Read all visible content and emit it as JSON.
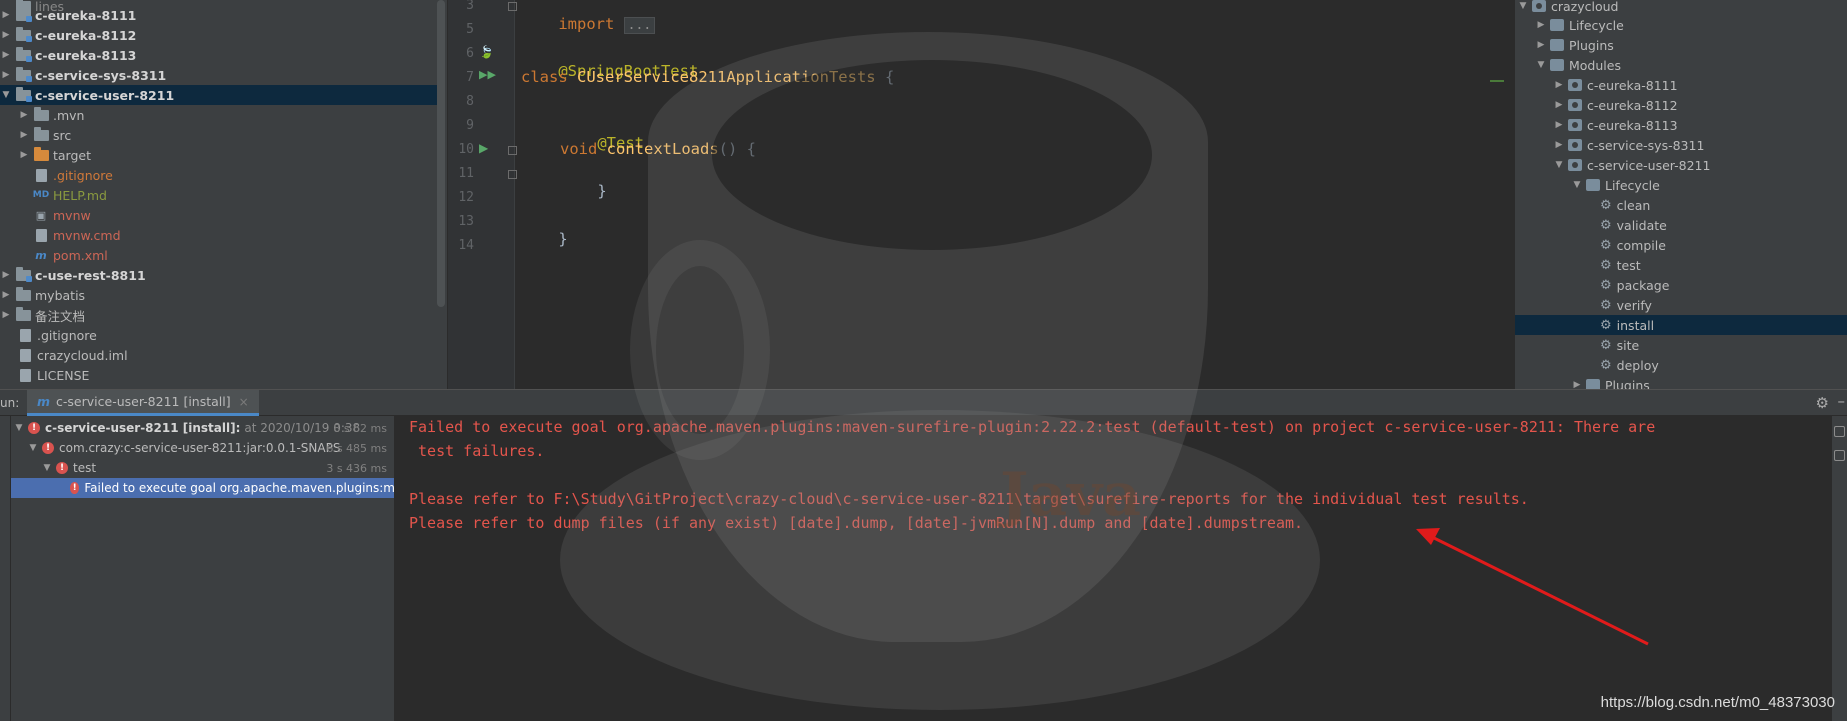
{
  "project_tree": {
    "items": [
      {
        "label": "c-eureka-8111",
        "style": "bold"
      },
      {
        "label": "c-eureka-8112",
        "style": "bold"
      },
      {
        "label": "c-eureka-8113",
        "style": "bold"
      },
      {
        "label": "c-service-sys-8311",
        "style": "bold"
      },
      {
        "label": "c-service-user-8211",
        "style": "bold"
      },
      {
        "label": ".mvn"
      },
      {
        "label": "src"
      },
      {
        "label": "target"
      },
      {
        "label": ".gitignore"
      },
      {
        "label": "HELP.md"
      },
      {
        "label": "mvnw"
      },
      {
        "label": "mvnw.cmd"
      },
      {
        "label": "pom.xml"
      },
      {
        "label": "c-use-rest-8811",
        "style": "bold"
      },
      {
        "label": "mybatis"
      },
      {
        "label": "备注文档"
      },
      {
        "label": ".gitignore"
      },
      {
        "label": "crazycloud.iml"
      },
      {
        "label": "LICENSE"
      }
    ]
  },
  "editor": {
    "line_numbers": [
      "3",
      "5",
      "6",
      "7",
      "8",
      "9",
      "10",
      "11",
      "12",
      "13",
      "14"
    ],
    "lines": {
      "l3_kw": "import",
      "l3_fold": "...",
      "l6_ann": "@SpringBootTest",
      "l7_kw": "class",
      "l7_cls": "CUserService8211ApplicationTests",
      "l7_brace": " {",
      "l9_ann": "@Test",
      "l10_kw": "void",
      "l10_method": "contextLoads",
      "l10_rest": "() {",
      "l11": "}",
      "l13": "}"
    }
  },
  "maven": {
    "items": [
      {
        "label": "crazycloud"
      },
      {
        "label": "Lifecycle"
      },
      {
        "label": "Plugins"
      },
      {
        "label": "Modules"
      },
      {
        "label": "c-eureka-8111"
      },
      {
        "label": "c-eureka-8112"
      },
      {
        "label": "c-eureka-8113"
      },
      {
        "label": "c-service-sys-8311"
      },
      {
        "label": "c-service-user-8211"
      },
      {
        "label": "Lifecycle"
      },
      {
        "label": "clean"
      },
      {
        "label": "validate"
      },
      {
        "label": "compile"
      },
      {
        "label": "test"
      },
      {
        "label": "package"
      },
      {
        "label": "verify"
      },
      {
        "label": "install"
      },
      {
        "label": "site"
      },
      {
        "label": "deploy"
      },
      {
        "label": "Plugins"
      }
    ]
  },
  "run": {
    "label": "un:",
    "tab_label": "c-service-user-8211 [install]",
    "tree": [
      {
        "label": "c-service-user-8211 [install]:",
        "at": "at 2020/10/19 0:38",
        "time": "8 s 62 ms"
      },
      {
        "label": "com.crazy:c-service-user-8211:jar:0.0.1-SNAPS",
        "time": "6 s 485 ms"
      },
      {
        "label": "test",
        "time": "3 s 436 ms"
      },
      {
        "label": "Failed to execute goal org.apache.maven.plugins:m"
      }
    ],
    "console": [
      "Failed to execute goal org.apache.maven.plugins:maven-surefire-plugin:2.22.2:test (default-test) on project c-service-user-8211: There are",
      " test failures.",
      "",
      "Please refer to F:\\Study\\GitProject\\crazy-cloud\\c-service-user-8211\\target\\surefire-reports for the individual test results.",
      "Please refer to dump files (if any exist) [date].dump, [date]-jvmRun[N].dump and [date].dumpstream."
    ]
  },
  "watermark": "https://blog.csdn.net/m0_48373030",
  "colors": {
    "error_red": "#e4554c",
    "selection": "#0d293e",
    "annotation_arrow": "#e01b1b"
  }
}
